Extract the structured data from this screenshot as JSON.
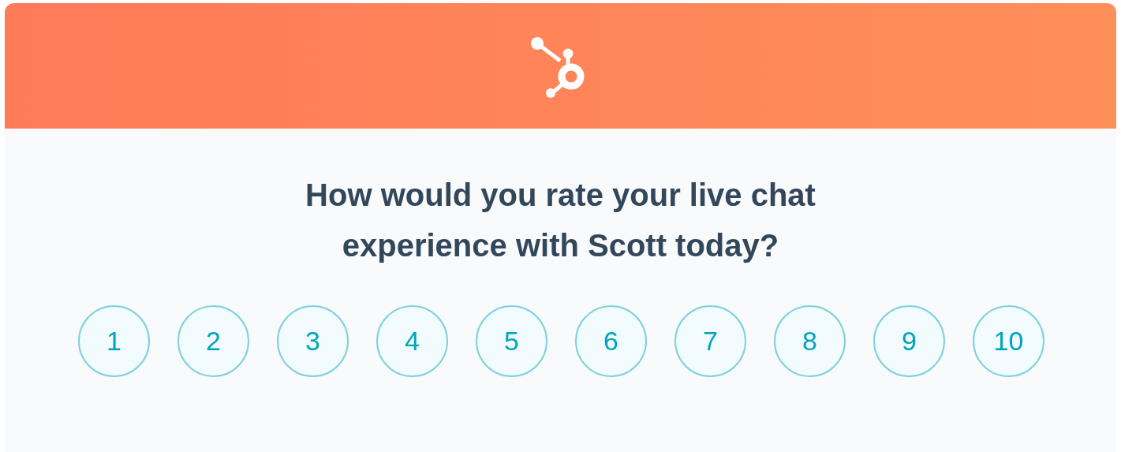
{
  "question": "How would you rate your live chat experience with Scott today?",
  "ratings": [
    {
      "label": "1",
      "selected": false
    },
    {
      "label": "2",
      "selected": false
    },
    {
      "label": "3",
      "selected": false
    },
    {
      "label": "4",
      "selected": false
    },
    {
      "label": "5",
      "selected": false
    },
    {
      "label": "6",
      "selected": false
    },
    {
      "label": "7",
      "selected": false
    },
    {
      "label": "8",
      "selected": false
    },
    {
      "label": "9",
      "selected": false
    },
    {
      "label": "10",
      "selected": false
    }
  ]
}
